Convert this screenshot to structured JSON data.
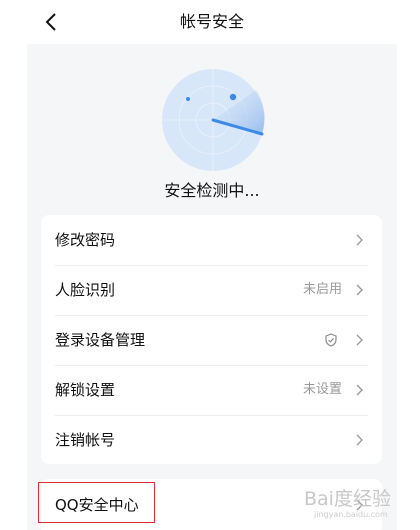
{
  "header": {
    "title": "帐号安全"
  },
  "scan": {
    "status_text": "安全检测中..."
  },
  "settings": {
    "items": [
      {
        "label": "修改密码",
        "status": ""
      },
      {
        "label": "人脸识别",
        "status": "未启用"
      },
      {
        "label": "登录设备管理",
        "status": "",
        "icon": "shield-check-icon"
      },
      {
        "label": "解锁设置",
        "status": "未设置"
      },
      {
        "label": "注销帐号",
        "status": ""
      }
    ]
  },
  "qq_center": {
    "label": "QQ安全中心"
  },
  "watermark": {
    "text": "Bai度经验",
    "sub": "jingyan.baidu.com"
  },
  "colors": {
    "accent": "#3d8ae6",
    "highlight_border": "#d8333b",
    "background": "#f5f6f7"
  }
}
